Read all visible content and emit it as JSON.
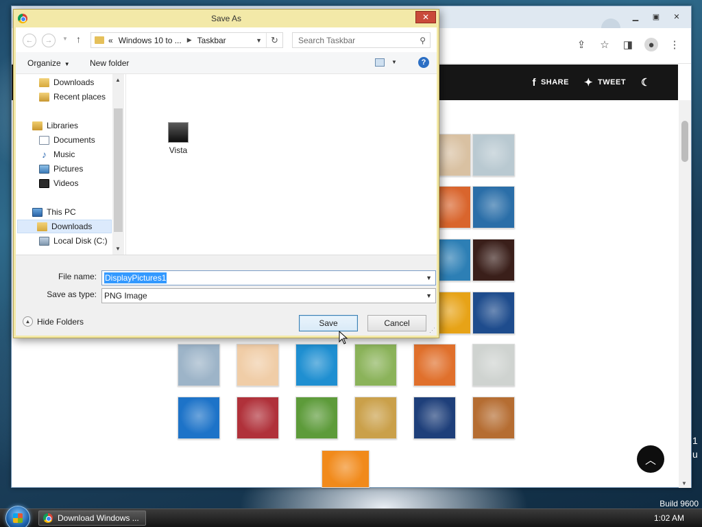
{
  "browser": {
    "site_links": {
      "share": "SHARE",
      "tweet": "TWEET"
    },
    "edge_text": "1\nu",
    "thumbnails": [
      {
        "name": "thumb-cartoon",
        "bg": "#d9c1a2"
      },
      {
        "name": "thumb-gyroscope",
        "bg": "#b9c9d1"
      },
      {
        "name": "thumb-fabric",
        "bg": "#d9652d"
      },
      {
        "name": "thumb-leaf",
        "bg": "#2a6ea8"
      },
      {
        "name": "thumb-blue",
        "bg": "#2d7fb5"
      },
      {
        "name": "thumb-crane",
        "bg": "#3a1f1a"
      },
      {
        "name": "thumb-sunflower",
        "bg": "#e7a317"
      },
      {
        "name": "thumb-fish",
        "bg": "#1e4c8d"
      },
      {
        "name": "thumb-balloon",
        "bg": "#9db4c8"
      },
      {
        "name": "thumb-doll",
        "bg": "#f0cda7"
      },
      {
        "name": "thumb-sailboat",
        "bg": "#1f8fd1"
      },
      {
        "name": "thumb-soccer",
        "bg": "#8bb35a"
      },
      {
        "name": "thumb-stripes",
        "bg": "#e0702c"
      },
      {
        "name": "thumb-marbles",
        "bg": "#cfd3d0"
      },
      {
        "name": "thumb-window",
        "bg": "#1d73c8"
      },
      {
        "name": "thumb-rug",
        "bg": "#b0313a"
      },
      {
        "name": "thumb-butterfly",
        "bg": "#5d9b3a"
      },
      {
        "name": "thumb-spiral",
        "bg": "#caa04a"
      },
      {
        "name": "thumb-lighthouse",
        "bg": "#1e3f7a"
      },
      {
        "name": "thumb-suitcase",
        "bg": "#b56d32"
      },
      {
        "name": "thumb-daisy",
        "bg": "#f18a1b"
      }
    ]
  },
  "dialog": {
    "title": "Save As",
    "breadcrumb": {
      "prefix": "«",
      "segment1": "Windows 10 to ...",
      "segment2": "Taskbar"
    },
    "search_placeholder": "Search Taskbar",
    "commands": {
      "organize": "Organize",
      "new_folder": "New folder"
    },
    "nav_items": [
      {
        "label": "Downloads",
        "icon": "i-folder-dl"
      },
      {
        "label": "Recent places",
        "icon": "i-recent"
      },
      {
        "label": "Libraries",
        "icon": "i-lib"
      },
      {
        "label": "Documents",
        "icon": "i-doc"
      },
      {
        "label": "Music",
        "icon": "i-music"
      },
      {
        "label": "Pictures",
        "icon": "i-pic"
      },
      {
        "label": "Videos",
        "icon": "i-vid"
      },
      {
        "label": "This PC",
        "icon": "i-pc"
      },
      {
        "label": "Downloads",
        "icon": "i-folder-dl"
      },
      {
        "label": "Local Disk (C:)",
        "icon": "i-disk"
      }
    ],
    "files": [
      {
        "label": "Vista"
      }
    ],
    "form": {
      "file_name_label": "File name:",
      "file_name_value": "DisplayPictures1",
      "save_type_label": "Save as type:",
      "save_type_value": "PNG Image",
      "hide_folders": "Hide Folders",
      "save": "Save",
      "cancel": "Cancel"
    }
  },
  "taskbar": {
    "task_label": "Download Windows ...",
    "clock": "1:02 AM",
    "build": "Build 9600"
  }
}
